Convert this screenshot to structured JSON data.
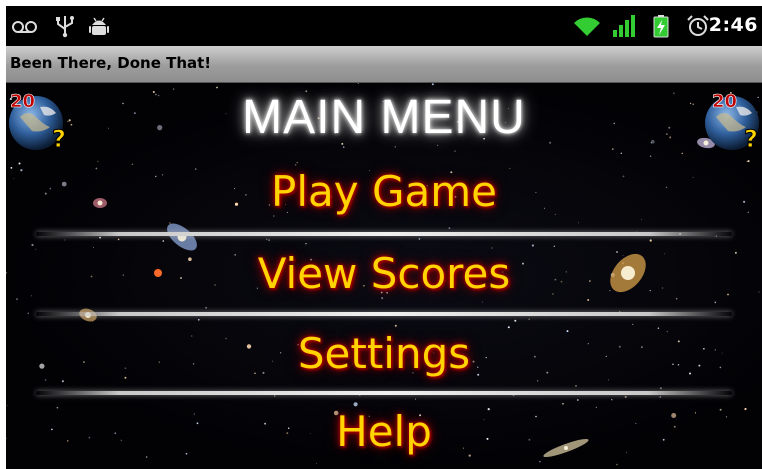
{
  "status_bar": {
    "icons": [
      "voicemail-icon",
      "usb-icon",
      "android-debug-icon",
      "wifi-icon",
      "signal-icon",
      "battery-charging-icon",
      "alarm-icon"
    ],
    "time": "2:46"
  },
  "app": {
    "title": "Been There, Done That!"
  },
  "menu": {
    "heading": "MAIN MENU",
    "items": [
      {
        "label": "Play Game"
      },
      {
        "label": "View Scores"
      },
      {
        "label": "Settings"
      },
      {
        "label": "Help"
      }
    ]
  },
  "logo": {
    "text": "20",
    "mark": "?"
  },
  "colors": {
    "menu_text": "#ffd400",
    "menu_glow": "#b00000",
    "heading_text": "#ffffff",
    "status_bar": "#000000",
    "wifi": "#33cc33"
  }
}
